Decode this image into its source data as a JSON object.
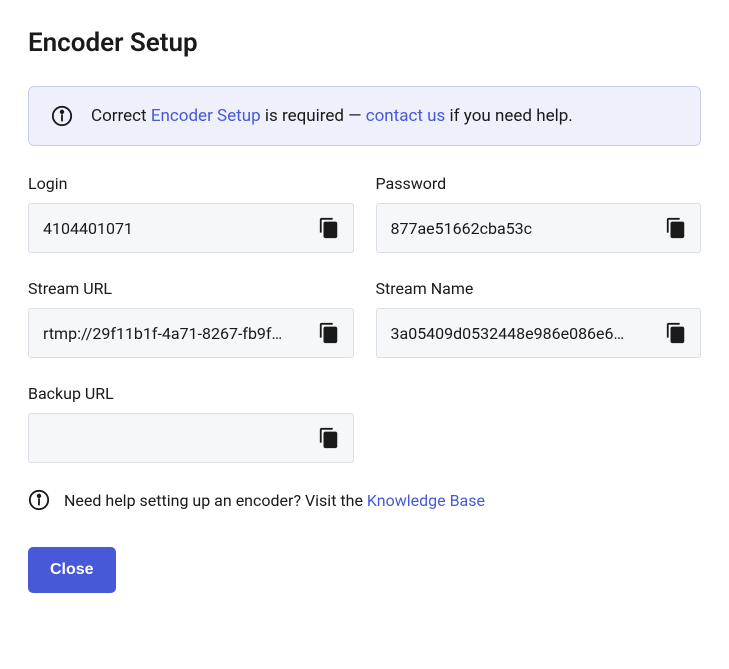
{
  "title": "Encoder Setup",
  "alert": {
    "prefix": "Correct ",
    "link1": "Encoder Setup",
    "mid": " is required — ",
    "link2": "contact us",
    "suffix": " if you need help."
  },
  "fields": {
    "login": {
      "label": "Login",
      "value": "4104401071"
    },
    "password": {
      "label": "Password",
      "value": "877ae51662cba53c"
    },
    "streamUrl": {
      "label": "Stream URL",
      "value": "rtmp://29f11b1f-4a71-8267-fb9f…"
    },
    "streamName": {
      "label": "Stream Name",
      "value": "3a05409d0532448e986e086e6…"
    },
    "backupUrl": {
      "label": "Backup URL",
      "value": ""
    }
  },
  "help": {
    "prefix": "Need help setting up an encoder? Visit the ",
    "link": "Knowledge Base"
  },
  "buttons": {
    "close": "Close"
  }
}
